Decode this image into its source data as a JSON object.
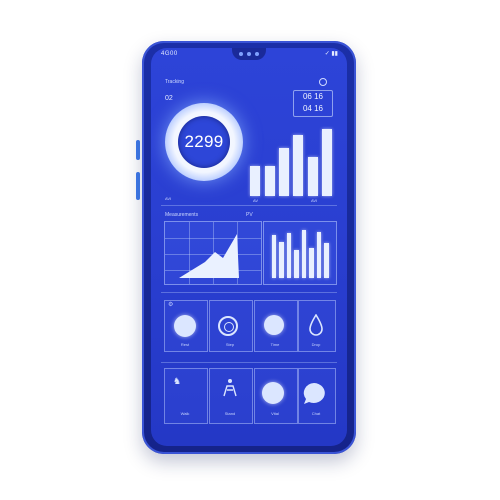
{
  "status_bar": {
    "left": "4G00",
    "right": "✓ ▮▮"
  },
  "app": {
    "title": "Tracking"
  },
  "header": {
    "left_value": "02",
    "time_line1": "06 16",
    "time_line2": "04 16"
  },
  "gauge": {
    "value": "2299",
    "progress": 0.75
  },
  "top_chart": {
    "bar_levels": [
      0.38,
      0.38,
      0.62,
      0.78,
      0.5,
      0.86
    ],
    "labels": [
      "AVI",
      "AV",
      "AVI"
    ]
  },
  "section2": {
    "title": "Measurements",
    "right_label": "PV"
  },
  "area_chart": {
    "peak_label": ""
  },
  "mid_chart": {
    "bar_levels": [
      0.85,
      0.72,
      0.9,
      0.55,
      0.95,
      0.6,
      0.92,
      0.7
    ]
  },
  "row1": {
    "header_icon": "settings-icon",
    "items": [
      {
        "icon": "circle-icon",
        "label": "Rest"
      },
      {
        "icon": "ring-icon",
        "label": "Step"
      },
      {
        "icon": "circle-icon",
        "label": "Time"
      },
      {
        "icon": "drop-icon",
        "label": "Drop"
      }
    ]
  },
  "row2": {
    "items": [
      {
        "icon": "runner-icon",
        "label": "Walk"
      },
      {
        "icon": "stand-icon",
        "label": "Stand"
      },
      {
        "icon": "circle-icon",
        "label": "Vital"
      },
      {
        "icon": "chat-icon",
        "label": "Chat"
      }
    ]
  },
  "colors": {
    "screen": "#2d44d8",
    "frame": "#1b2fa8",
    "accent": "#e9f0ff"
  }
}
